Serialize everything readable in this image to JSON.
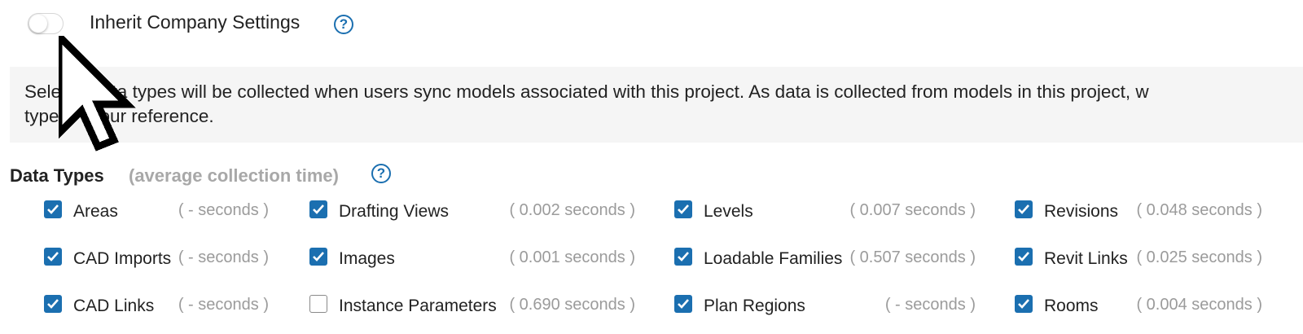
{
  "header": {
    "inherit_label": "Inherit Company Settings",
    "inherit_toggle_on": false,
    "help_glyph": "?"
  },
  "notice": {
    "text_line1": "Sele        ata types will be collected when users sync models associated with this project. As data is collected from models in this project, w",
    "text_line2": "type        our reference."
  },
  "data_types": {
    "title": "Data Types",
    "subtitle": "(average collection time)",
    "columns": [
      [
        {
          "label": "Areas",
          "time": "( - seconds )",
          "checked": true
        },
        {
          "label": "CAD Imports",
          "time": "( - seconds )",
          "checked": true
        },
        {
          "label": "CAD Links",
          "time": "( - seconds )",
          "checked": true
        }
      ],
      [
        {
          "label": "Drafting Views",
          "time": "( 0.002 seconds )",
          "checked": true
        },
        {
          "label": "Images",
          "time": "( 0.001 seconds )",
          "checked": true
        },
        {
          "label": "Instance Parameters",
          "time": "( 0.690 seconds )",
          "checked": false
        }
      ],
      [
        {
          "label": "Levels",
          "time": "( 0.007 seconds )",
          "checked": true
        },
        {
          "label": "Loadable Families",
          "time": "( 0.507 seconds )",
          "checked": true
        },
        {
          "label": "Plan Regions",
          "time": "( - seconds )",
          "checked": true
        }
      ],
      [
        {
          "label": "Revisions",
          "time": "( 0.048 seconds )",
          "checked": true
        },
        {
          "label": "Revit Links",
          "time": "( 0.025 seconds )",
          "checked": true
        },
        {
          "label": "Rooms",
          "time": "( 0.004 seconds )",
          "checked": true
        }
      ]
    ]
  },
  "colors": {
    "accent": "#1b6fb0",
    "muted": "#9b9b9b",
    "notice_bg": "#f5f5f5"
  }
}
